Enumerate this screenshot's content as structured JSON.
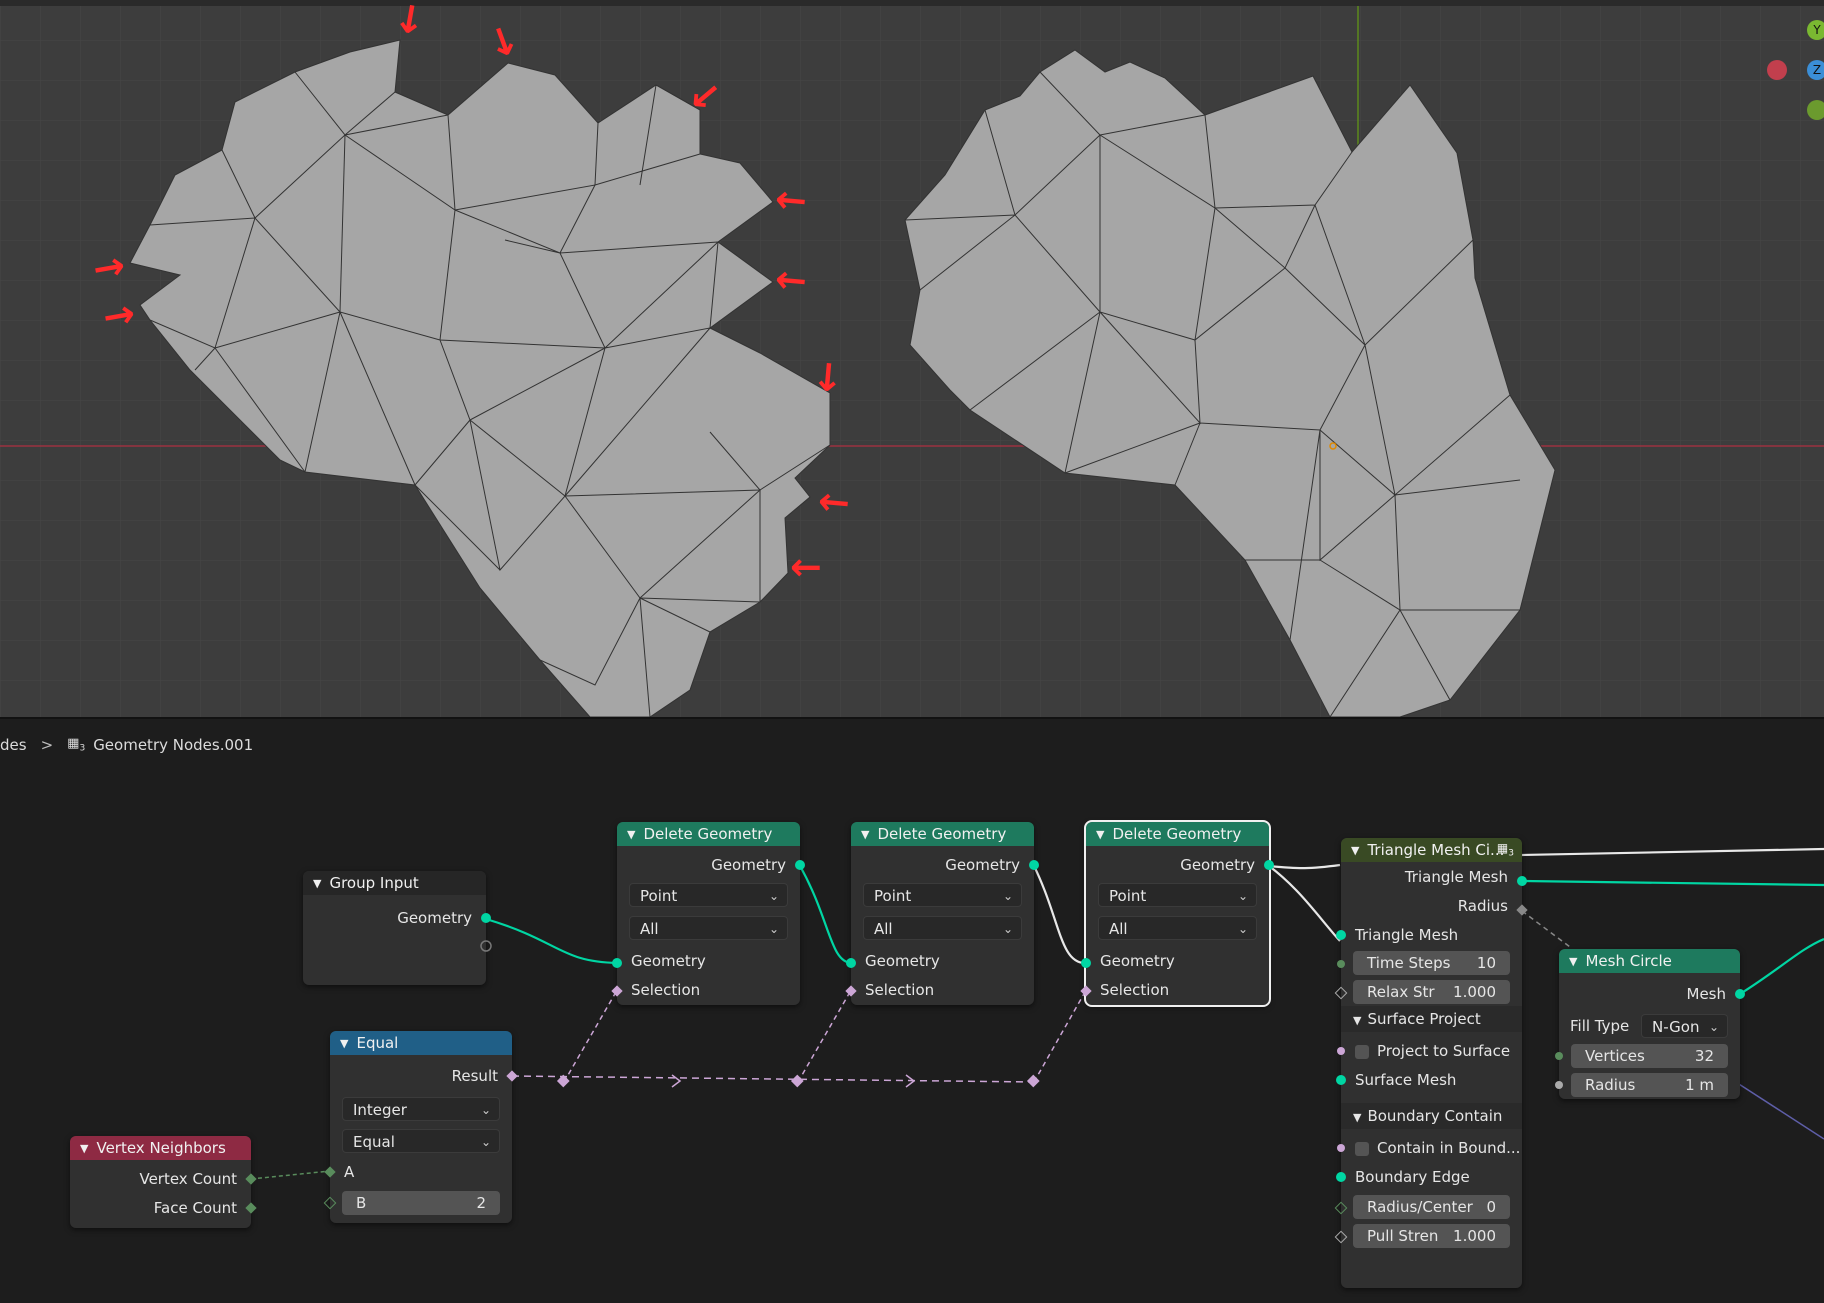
{
  "viewport": {
    "arrow_glyph": "→",
    "gizmo": {
      "y": "Y",
      "z": "Z"
    }
  },
  "breadcrumb": {
    "partial": "des",
    "separator": ">",
    "tree_icon": "node-tree-icon",
    "user_count": "3",
    "tree_name": "Geometry Nodes.001"
  },
  "nodes": {
    "group_input": {
      "title": "Group Input",
      "geometry": "Geometry"
    },
    "delete1": {
      "title": "Delete Geometry",
      "geometry_out": "Geometry",
      "domain": "Point",
      "mode": "All",
      "geometry_in": "Geometry",
      "selection": "Selection"
    },
    "delete2": {
      "title": "Delete Geometry",
      "geometry_out": "Geometry",
      "domain": "Point",
      "mode": "All",
      "geometry_in": "Geometry",
      "selection": "Selection"
    },
    "delete3": {
      "title": "Delete Geometry",
      "geometry_out": "Geometry",
      "domain": "Point",
      "mode": "All",
      "geometry_in": "Geometry",
      "selection": "Selection"
    },
    "equal": {
      "title": "Equal",
      "result": "Result",
      "data_type": "Integer",
      "operation": "Equal",
      "a": "A",
      "b_label": "B",
      "b_value": "2"
    },
    "vertex_neighbors": {
      "title": "Vertex Neighbors",
      "vertex_count": "Vertex Count",
      "face_count": "Face Count"
    },
    "triangle_mesh": {
      "title": "Triangle Mesh Ci...",
      "badge": "3",
      "triangle_mesh_out": "Triangle Mesh",
      "radius_out": "Radius",
      "triangle_mesh_in": "Triangle Mesh",
      "time_steps_label": "Time Steps",
      "time_steps_value": "10",
      "relax_label": "Relax Str",
      "relax_value": "1.000",
      "panel_surface": "Surface Project",
      "project_to_surface": "Project to Surface",
      "surface_mesh": "Surface Mesh",
      "panel_boundary": "Boundary Contain",
      "contain_in_boundary": "Contain in Bound...",
      "boundary_edge": "Boundary Edge",
      "radius_center_label": "Radius/Center",
      "radius_center_value": "0",
      "pull_label": "Pull Stren",
      "pull_value": "1.000"
    },
    "mesh_circle": {
      "title": "Mesh Circle",
      "mesh": "Mesh",
      "fill_type_label": "Fill Type",
      "fill_type_value": "N-Gon",
      "vertices_label": "Vertices",
      "vertices_value": "32",
      "radius_label": "Radius",
      "radius_value": "1 m"
    }
  },
  "colors": {
    "viewport_bg": "#3d3d3d",
    "mesh_fill": "#a6a6a6",
    "geometry_socket": "#00d6a3",
    "field_socket": "#cca6d6",
    "int_socket": "#598c5c",
    "annotation": "#ff2a2a",
    "x_axis": "#9b3240",
    "y_axis": "#5d8a1d"
  }
}
